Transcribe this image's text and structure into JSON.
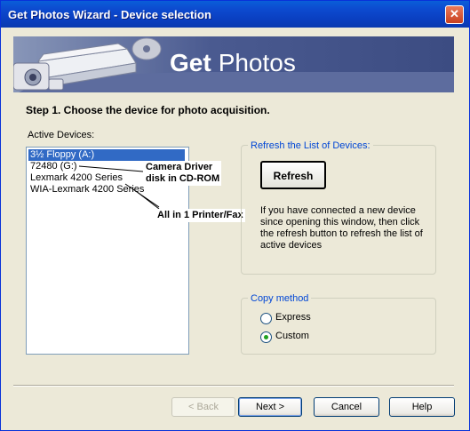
{
  "window": {
    "title": "Get Photos Wizard - Device selection",
    "close_label": "✕"
  },
  "banner": {
    "title_bold": "Get",
    "title_rest": "Photos"
  },
  "step_title": "Step 1. Choose the device for photo acquisition.",
  "active_devices": {
    "label": "Active Devices:",
    "items": [
      {
        "label": "3½ Floppy (A:)",
        "selected": true
      },
      {
        "label": "72480 (G:)",
        "selected": false
      },
      {
        "label": "Lexmark 4200 Series",
        "selected": false
      },
      {
        "label": "WIA-Lexmark 4200 Series",
        "selected": false
      }
    ]
  },
  "annotations": {
    "camera_line1": "Camera Driver",
    "camera_line2": "disk in CD-ROM",
    "printer": "All in 1 Printer/Fax"
  },
  "refresh_group": {
    "label": "Refresh the List of Devices:",
    "button": "Refresh",
    "description": "If you have connected a new device since opening this window, then click the refresh button to refresh the list of active devices"
  },
  "copy_method": {
    "label": "Copy method",
    "options": [
      {
        "label": "Express",
        "selected": false
      },
      {
        "label": "Custom",
        "selected": true
      }
    ]
  },
  "buttons": {
    "back": "< Back",
    "next": "Next >",
    "cancel": "Cancel",
    "help": "Help"
  }
}
